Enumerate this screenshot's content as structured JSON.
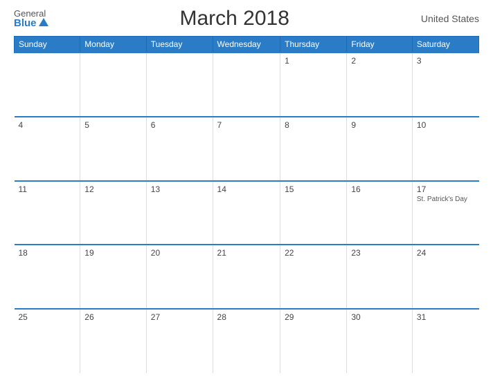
{
  "header": {
    "logo_general": "General",
    "logo_blue": "Blue",
    "title": "March 2018",
    "country": "United States"
  },
  "calendar": {
    "weekdays": [
      "Sunday",
      "Monday",
      "Tuesday",
      "Wednesday",
      "Thursday",
      "Friday",
      "Saturday"
    ],
    "weeks": [
      [
        {
          "day": "",
          "empty": true
        },
        {
          "day": "",
          "empty": true
        },
        {
          "day": "",
          "empty": true
        },
        {
          "day": "",
          "empty": true
        },
        {
          "day": "1",
          "empty": false
        },
        {
          "day": "2",
          "empty": false
        },
        {
          "day": "3",
          "empty": false
        }
      ],
      [
        {
          "day": "4",
          "empty": false
        },
        {
          "day": "5",
          "empty": false
        },
        {
          "day": "6",
          "empty": false
        },
        {
          "day": "7",
          "empty": false
        },
        {
          "day": "8",
          "empty": false
        },
        {
          "day": "9",
          "empty": false
        },
        {
          "day": "10",
          "empty": false
        }
      ],
      [
        {
          "day": "11",
          "empty": false
        },
        {
          "day": "12",
          "empty": false
        },
        {
          "day": "13",
          "empty": false
        },
        {
          "day": "14",
          "empty": false
        },
        {
          "day": "15",
          "empty": false
        },
        {
          "day": "16",
          "empty": false
        },
        {
          "day": "17",
          "holiday": "St. Patrick's Day",
          "empty": false
        }
      ],
      [
        {
          "day": "18",
          "empty": false
        },
        {
          "day": "19",
          "empty": false
        },
        {
          "day": "20",
          "empty": false
        },
        {
          "day": "21",
          "empty": false
        },
        {
          "day": "22",
          "empty": false
        },
        {
          "day": "23",
          "empty": false
        },
        {
          "day": "24",
          "empty": false
        }
      ],
      [
        {
          "day": "25",
          "empty": false
        },
        {
          "day": "26",
          "empty": false
        },
        {
          "day": "27",
          "empty": false
        },
        {
          "day": "28",
          "empty": false
        },
        {
          "day": "29",
          "empty": false
        },
        {
          "day": "30",
          "empty": false
        },
        {
          "day": "31",
          "empty": false
        }
      ]
    ]
  }
}
